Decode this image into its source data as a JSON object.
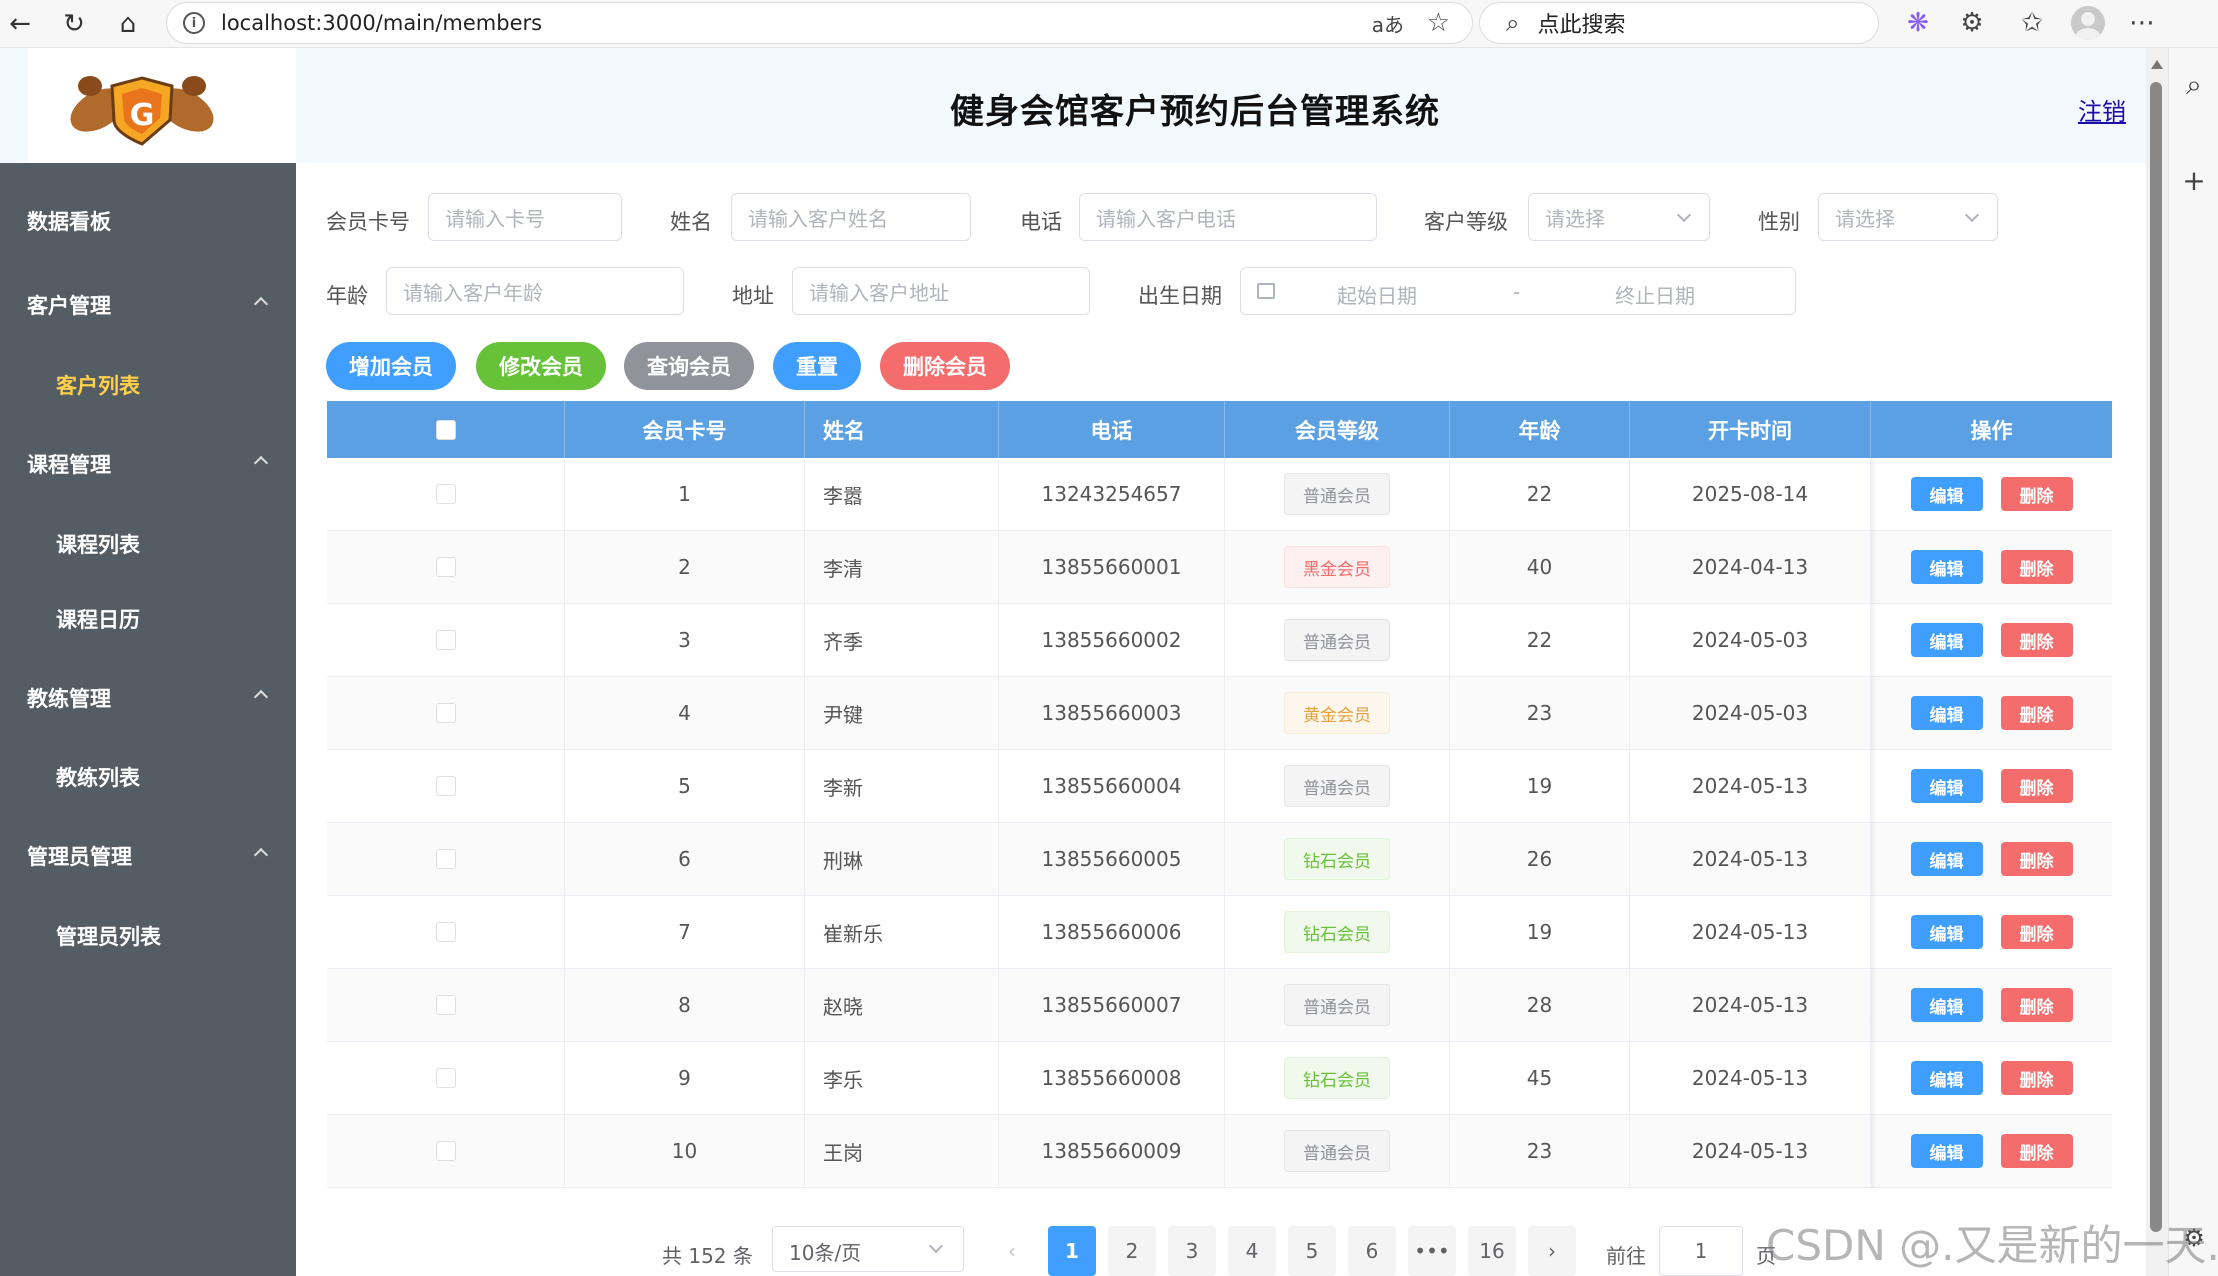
{
  "browser": {
    "url": "localhost:3000/main/members",
    "search_placeholder": "点此搜索",
    "translate_label": "aあ"
  },
  "header": {
    "title": "健身会馆客户预约后台管理系统",
    "logout": "注销"
  },
  "sidebar": {
    "items": [
      {
        "label": "数据看板"
      },
      {
        "label": "客户管理"
      },
      {
        "label": "客户列表"
      },
      {
        "label": "课程管理"
      },
      {
        "label": "课程列表"
      },
      {
        "label": "课程日历"
      },
      {
        "label": "教练管理"
      },
      {
        "label": "教练列表"
      },
      {
        "label": "管理员管理"
      },
      {
        "label": "管理员列表"
      }
    ]
  },
  "filters": {
    "card_label": "会员卡号",
    "card_placeholder": "请输入卡号",
    "name_label": "姓名",
    "name_placeholder": "请输入客户姓名",
    "phone_label": "电话",
    "phone_placeholder": "请输入客户电话",
    "level_label": "客户等级",
    "level_placeholder": "请选择",
    "gender_label": "性别",
    "gender_placeholder": "请选择",
    "age_label": "年龄",
    "age_placeholder": "请输入客户年龄",
    "address_label": "地址",
    "address_placeholder": "请输入客户地址",
    "birth_label": "出生日期",
    "birth_start": "起始日期",
    "birth_sep": "-",
    "birth_end": "终止日期"
  },
  "actions": {
    "add": "增加会员",
    "modify": "修改会员",
    "query": "查询会员",
    "reset": "重置",
    "delete": "删除会员"
  },
  "colors": {
    "sidebar_bg": "#545c64",
    "active_menu": "#ffd04b",
    "table_header": "#5aa0e3",
    "primary": "#409eff",
    "success": "#67c23a",
    "info": "#909399",
    "danger": "#f56c6c"
  },
  "table": {
    "columns": [
      "",
      "会员卡号",
      "姓名",
      "电话",
      "会员等级",
      "年龄",
      "开卡时间",
      "操作"
    ],
    "edit_label": "编辑",
    "delete_label": "删除",
    "rows": [
      {
        "id": "1",
        "name": "李嚣",
        "phone": "13243254657",
        "level": "普通会员",
        "level_type": "normal",
        "age": "22",
        "date": "2025-08-14"
      },
      {
        "id": "2",
        "name": "李清",
        "phone": "13855660001",
        "level": "黑金会员",
        "level_type": "black",
        "age": "40",
        "date": "2024-04-13"
      },
      {
        "id": "3",
        "name": "齐季",
        "phone": "13855660002",
        "level": "普通会员",
        "level_type": "normal",
        "age": "22",
        "date": "2024-05-03"
      },
      {
        "id": "4",
        "name": "尹键",
        "phone": "13855660003",
        "level": "黄金会员",
        "level_type": "gold",
        "age": "23",
        "date": "2024-05-03"
      },
      {
        "id": "5",
        "name": "李新",
        "phone": "13855660004",
        "level": "普通会员",
        "level_type": "normal",
        "age": "19",
        "date": "2024-05-13"
      },
      {
        "id": "6",
        "name": "刑琳",
        "phone": "13855660005",
        "level": "钻石会员",
        "level_type": "diamond",
        "age": "26",
        "date": "2024-05-13"
      },
      {
        "id": "7",
        "name": "崔新乐",
        "phone": "13855660006",
        "level": "钻石会员",
        "level_type": "diamond",
        "age": "19",
        "date": "2024-05-13"
      },
      {
        "id": "8",
        "name": "赵晓",
        "phone": "13855660007",
        "level": "普通会员",
        "level_type": "normal",
        "age": "28",
        "date": "2024-05-13"
      },
      {
        "id": "9",
        "name": "李乐",
        "phone": "13855660008",
        "level": "钻石会员",
        "level_type": "diamond",
        "age": "45",
        "date": "2024-05-13"
      },
      {
        "id": "10",
        "name": "王岗",
        "phone": "13855660009",
        "level": "普通会员",
        "level_type": "normal",
        "age": "23",
        "date": "2024-05-13"
      }
    ]
  },
  "pagination": {
    "total": "共 152 条",
    "page_size": "10条/页",
    "pages": [
      "1",
      "2",
      "3",
      "4",
      "5",
      "6",
      "•••",
      "16"
    ],
    "current": "1",
    "goto_label": "前往",
    "goto_value": "1",
    "page_suffix": "页"
  },
  "watermark": "CSDN @.又是新的一天."
}
